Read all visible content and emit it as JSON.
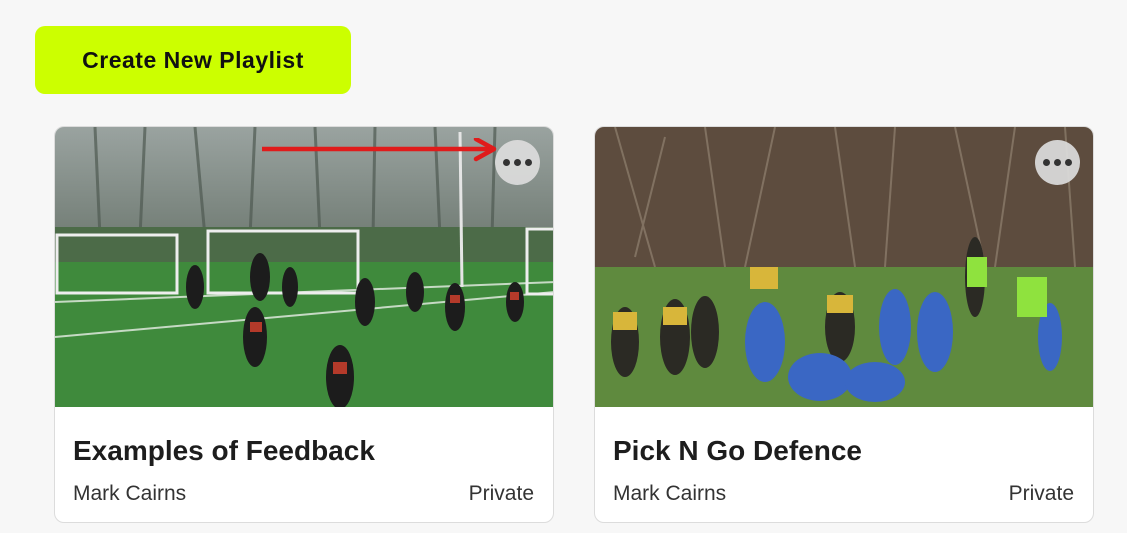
{
  "toolbar": {
    "create_label": "Create New Playlist"
  },
  "playlists": [
    {
      "title": "Examples of Feedback",
      "author": "Mark Cairns",
      "privacy": "Private"
    },
    {
      "title": "Pick N Go Defence",
      "author": "Mark Cairns",
      "privacy": "Private"
    }
  ],
  "colors": {
    "accent": "#ccff00",
    "annotation_arrow": "#e01b1b",
    "turf": "#3f8a3c"
  },
  "icons": {
    "more": "more-horizontal-icon",
    "annotation": "red-arrow-icon"
  }
}
